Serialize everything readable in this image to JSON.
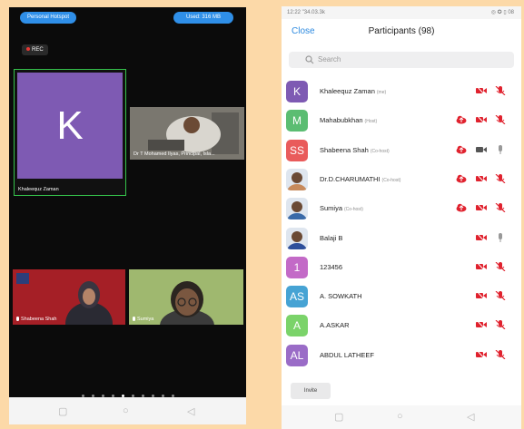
{
  "left_phone": {
    "top_left_button": "Personal Hotspot",
    "top_right_button": "Used: 316 MB",
    "rec_label": "REC",
    "tiles": {
      "self": {
        "initial": "K",
        "name": "Khaleequz Zaman"
      },
      "principal": {
        "name": "Dr T Mohamed Ilyas, Principal, Isla..."
      },
      "shabeena": {
        "name": "Shabeena Shah"
      },
      "sumiya": {
        "name": "Sumiya"
      }
    },
    "page_dots": 10,
    "active_dot": 4,
    "nav": {
      "recent": "▢",
      "home": "○",
      "back": "◁"
    }
  },
  "right_phone": {
    "status_time": "12:22 \"34.03.3k",
    "status_icons": "◎ ✪ ▯ 08",
    "header": {
      "close": "Close",
      "title": "Participants (98)"
    },
    "search_placeholder": "Search",
    "participants": [
      {
        "initial": "K",
        "name": "Khaleequz Zaman",
        "role": "(me)",
        "color": "#7e5ab3",
        "share": false,
        "video": "off",
        "mic": "off"
      },
      {
        "initial": "M",
        "name": "Mahabubkhan",
        "role": "(Host)",
        "color": "#5bbd72",
        "share": true,
        "video": "off",
        "mic": "off"
      },
      {
        "initial": "SS",
        "name": "Shabeena Shah",
        "role": "(Co-host)",
        "color": "#e95b5b",
        "share": true,
        "video": "on",
        "mic": "on"
      },
      {
        "initial": "",
        "name": "Dr.D.CHARUMATHI",
        "role": "(Co-host)",
        "color": "#c78a5c",
        "photo": true,
        "share": true,
        "video": "off",
        "mic": "off"
      },
      {
        "initial": "",
        "name": "Sumiya",
        "role": "(Co-host)",
        "color": "#3a6aa8",
        "photo": true,
        "share": true,
        "video": "off",
        "mic": "off"
      },
      {
        "initial": "",
        "name": "Balaji B",
        "role": "",
        "color": "#2d4f9b",
        "photo": true,
        "share": false,
        "video": "off",
        "mic": "on"
      },
      {
        "initial": "1",
        "name": "123456",
        "role": "",
        "color": "#c36ac7",
        "share": false,
        "video": "off",
        "mic": "off"
      },
      {
        "initial": "AS",
        "name": "A. SOWKATH",
        "role": "",
        "color": "#46a3d4",
        "share": false,
        "video": "off",
        "mic": "off"
      },
      {
        "initial": "A",
        "name": "A.ASKAR",
        "role": "",
        "color": "#7bd36a",
        "share": false,
        "video": "off",
        "mic": "off"
      },
      {
        "initial": "AL",
        "name": "ABDUL LATHEEF",
        "role": "",
        "color": "#9a6cc7",
        "share": false,
        "video": "off",
        "mic": "off"
      }
    ],
    "invite_label": "Invite",
    "nav": {
      "recent": "▢",
      "home": "○",
      "back": "◁"
    }
  },
  "colors": {
    "muted_red": "#e0222e",
    "host_border": "#35c24b",
    "accent_blue": "#2f8fe8"
  }
}
